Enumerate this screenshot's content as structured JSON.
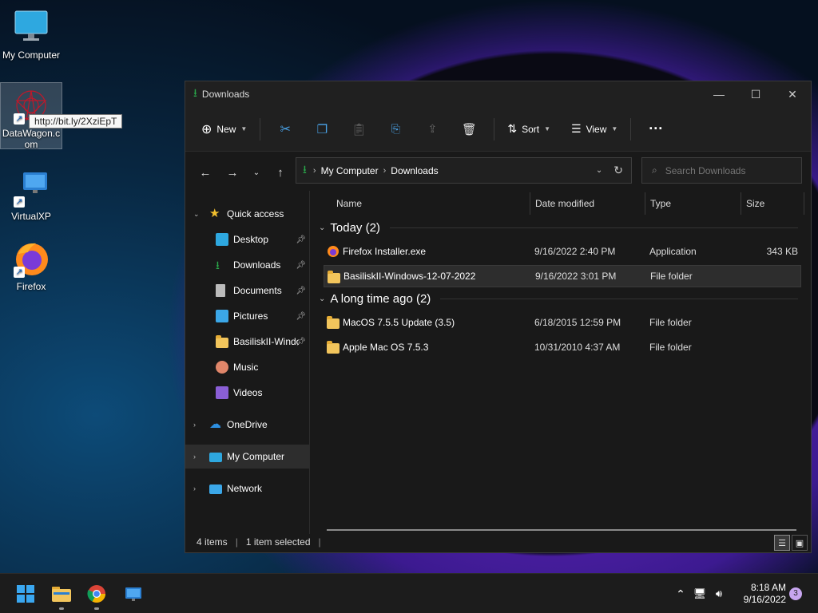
{
  "desktop": {
    "icons": [
      {
        "label": "My Computer"
      },
      {
        "label": "DataWagon.com"
      },
      {
        "label": "VirtualXP"
      },
      {
        "label": "Firefox"
      }
    ],
    "tooltip": "http://bit.ly/2XziEpT"
  },
  "window": {
    "title": "Downloads",
    "toolbar": {
      "new_label": "New",
      "sort_label": "Sort",
      "view_label": "View"
    },
    "address": {
      "crumbs": [
        "My Computer",
        "Downloads"
      ]
    },
    "search": {
      "placeholder": "Search Downloads"
    },
    "sidebar": {
      "quick_access": "Quick access",
      "items": [
        {
          "label": "Desktop"
        },
        {
          "label": "Downloads"
        },
        {
          "label": "Documents"
        },
        {
          "label": "Pictures"
        },
        {
          "label": "BasiliskII-Windows"
        },
        {
          "label": "Music"
        },
        {
          "label": "Videos"
        }
      ],
      "onedrive": "OneDrive",
      "mycomputer": "My Computer",
      "network": "Network"
    },
    "columns": {
      "name": "Name",
      "date": "Date modified",
      "type": "Type",
      "size": "Size"
    },
    "groups": [
      {
        "label": "Today (2)",
        "rows": [
          {
            "name": "Firefox Installer.exe",
            "date": "9/16/2022 2:40 PM",
            "type": "Application",
            "size": "343 KB"
          },
          {
            "name": "BasiliskII-Windows-12-07-2022",
            "date": "9/16/2022 3:01 PM",
            "type": "File folder",
            "size": ""
          }
        ]
      },
      {
        "label": "A long time ago (2)",
        "rows": [
          {
            "name": "MacOS 7.5.5 Update (3.5)",
            "date": "6/18/2015 12:59 PM",
            "type": "File folder",
            "size": ""
          },
          {
            "name": "Apple Mac OS 7.5.3",
            "date": "10/31/2010 4:37 AM",
            "type": "File folder",
            "size": ""
          }
        ]
      }
    ],
    "status": {
      "items": "4 items",
      "selected": "1 item selected"
    }
  },
  "taskbar": {
    "time": "8:18 AM",
    "date": "9/16/2022",
    "notifications": "3"
  },
  "colors": {
    "accent": "#2aa84a",
    "folder": "#f2c55c",
    "selection": "#2d2d2d"
  }
}
